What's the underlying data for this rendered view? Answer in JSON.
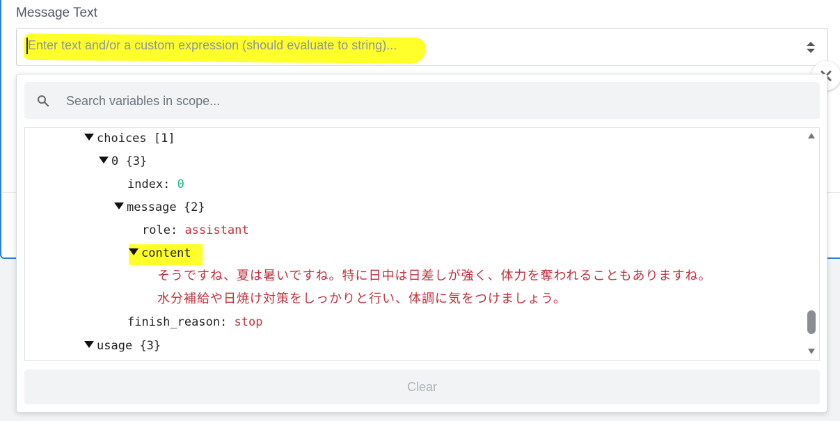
{
  "field": {
    "label": "Message Text",
    "placeholder": "Enter text and/or a custom expression (should evaluate to string)..."
  },
  "icons": {
    "sort": "sort-updown-icon",
    "close": "close-icon",
    "search": "search-icon",
    "scroll_up": "caret-up-icon",
    "scroll_down": "caret-down-icon"
  },
  "search": {
    "placeholder": "Search variables in scope..."
  },
  "tree": {
    "choices": {
      "key": "choices",
      "meta": "[1]"
    },
    "choice0": {
      "key": "0",
      "meta": "{3}"
    },
    "index": {
      "key": "index:",
      "value": "0"
    },
    "message": {
      "key": "message",
      "meta": "{2}"
    },
    "role": {
      "key": "role:",
      "value": "assistant"
    },
    "content": {
      "key": "content",
      "lines": [
        "そうですね、夏は暑いですね。特に日中は日差しが強く、体力を奪われることもありますね。",
        "水分補給や日焼け対策をしっかりと行い、体調に気をつけましょう。"
      ]
    },
    "finish_reason": {
      "key": "finish_reason:",
      "value": "stop"
    },
    "usage": {
      "key": "usage",
      "meta": "{3}"
    }
  },
  "clear_label": "Clear",
  "colors": {
    "highlight": "#ffff2a",
    "number_value": "#20b38a",
    "string_value": "#c0303b",
    "accent_border": "#2f7fd6"
  }
}
